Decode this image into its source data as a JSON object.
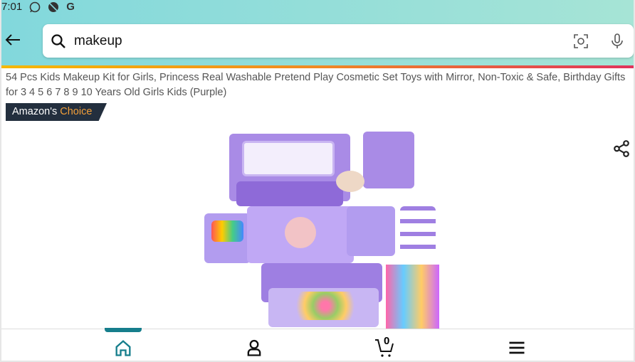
{
  "status_bar": {
    "time": "7:01",
    "icons": [
      "whatsapp-icon",
      "blocked-icon",
      "google-icon"
    ]
  },
  "search": {
    "value": "makeup",
    "icons": [
      "back-arrow-icon",
      "search-icon",
      "camera-scan-icon",
      "microphone-icon"
    ]
  },
  "product": {
    "title": "54 Pcs Kids Makeup Kit for Girls, Princess Real Washable Pretend Play Cosmetic Set Toys with Mirror, Non-Toxic & Safe, Birthday Gifts for 3 4 5 6 7 8 9 10 Years Old Girls Kids (Purple)",
    "badge_prefix": "Amazon's",
    "badge_highlight": "Choice"
  },
  "bottom_nav": {
    "items": [
      "home",
      "account",
      "cart",
      "menu"
    ],
    "active": "home",
    "cart_count": "0"
  },
  "colors": {
    "header": "#82d8dc",
    "badge_bg": "#232f3e",
    "badge_accent": "#f19e39",
    "active_nav": "#167e8c"
  }
}
